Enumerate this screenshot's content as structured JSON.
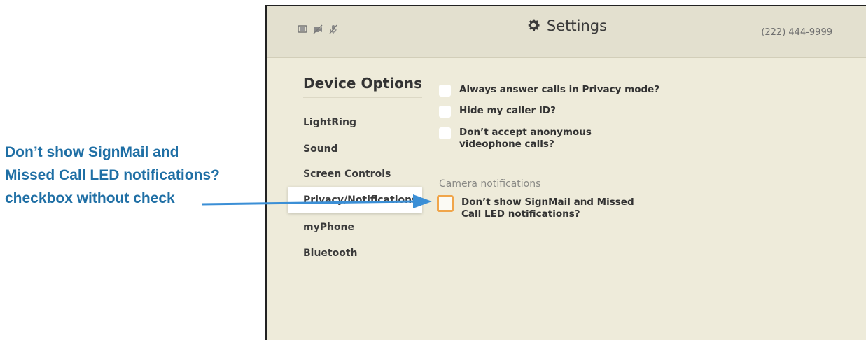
{
  "callout": {
    "lines": [
      "Don’t show SignMail and",
      "Missed Call LED notifications?",
      "checkbox without check"
    ]
  },
  "header": {
    "title": "Settings",
    "phone_number": "(222) 444-9999",
    "status_icons": [
      "monitor-icon",
      "camera-off-icon",
      "mic-off-icon"
    ]
  },
  "sidebar": {
    "title": "Device Options",
    "items": [
      {
        "label": "LightRing"
      },
      {
        "label": "Sound"
      },
      {
        "label": "Screen Controls"
      },
      {
        "label": "Privacy/Notifications",
        "selected": true
      },
      {
        "label": "myPhone"
      },
      {
        "label": "Bluetooth"
      }
    ]
  },
  "options": [
    {
      "label": "Always answer calls in Privacy mode?",
      "checked": false
    },
    {
      "label": "Hide my caller ID?",
      "checked": false
    },
    {
      "label": "Don’t accept anonymous\nvideophone calls?",
      "checked": false
    }
  ],
  "camera_section": {
    "title": "Camera notifications",
    "options": [
      {
        "label": "Don’t show SignMail and Missed\nCall LED notifications?",
        "checked": false,
        "focused": true
      }
    ]
  },
  "colors": {
    "callout_text": "#1f6fa5",
    "arrow": "#3b8fd6",
    "screen_bg": "#eeebda",
    "focus_ring": "#f0a54a"
  }
}
